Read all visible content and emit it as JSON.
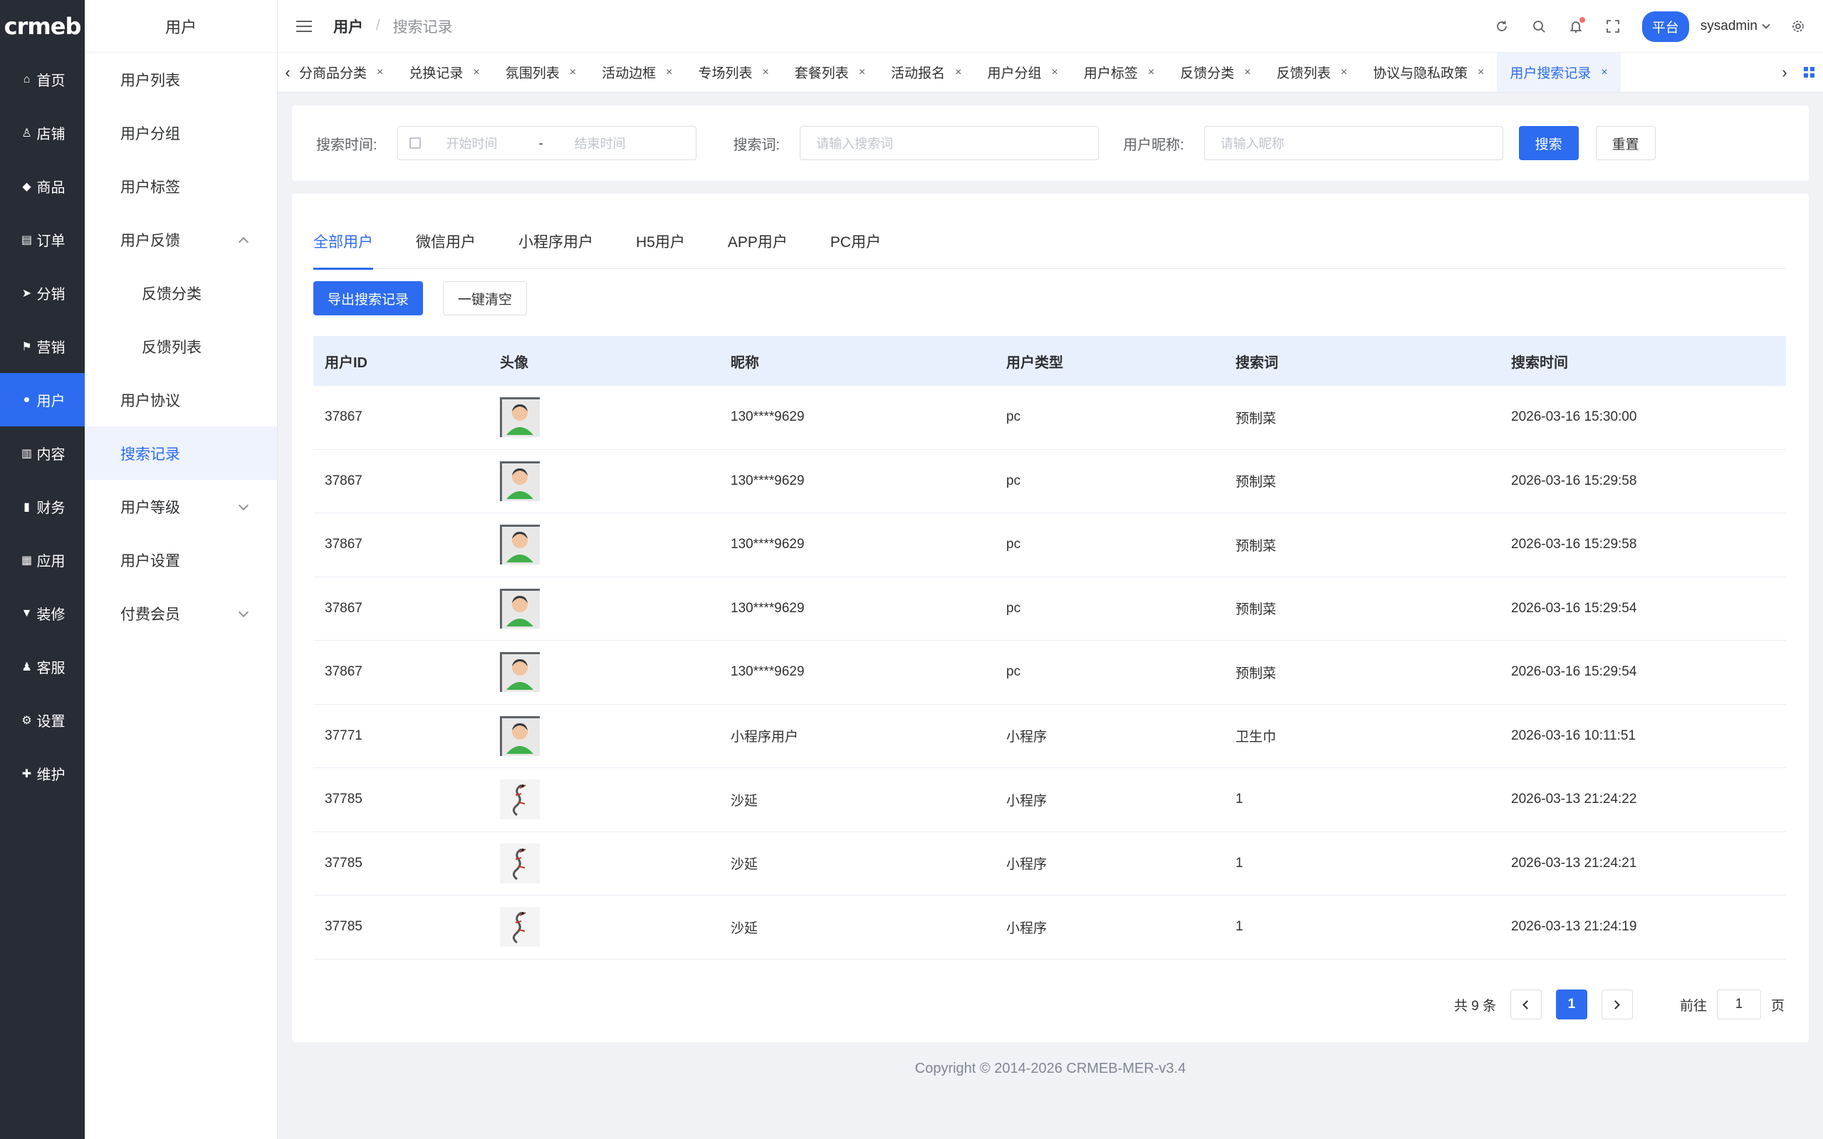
{
  "brand": {
    "logo": "crmeb",
    "accent": "#2d6cf0",
    "sidebar_bg": "#282c34"
  },
  "rail": [
    {
      "label": "首页",
      "icon": "home-icon",
      "glyph": "⌂"
    },
    {
      "label": "店铺",
      "icon": "store-icon",
      "glyph": "♙"
    },
    {
      "label": "商品",
      "icon": "goods-icon",
      "glyph": "◆"
    },
    {
      "label": "订单",
      "icon": "order-icon",
      "glyph": "▤"
    },
    {
      "label": "分销",
      "icon": "send-icon",
      "glyph": "➤"
    },
    {
      "label": "营销",
      "icon": "flag-icon",
      "glyph": "⚑"
    },
    {
      "label": "用户",
      "icon": "user-icon",
      "glyph": "●",
      "active": true
    },
    {
      "label": "内容",
      "icon": "content-icon",
      "glyph": "▥"
    },
    {
      "label": "财务",
      "icon": "finance-icon",
      "glyph": "▮"
    },
    {
      "label": "应用",
      "icon": "apps-icon",
      "glyph": "▦"
    },
    {
      "label": "装修",
      "icon": "decor-icon",
      "glyph": "▼"
    },
    {
      "label": "客服",
      "icon": "service-icon",
      "glyph": "♟"
    },
    {
      "label": "设置",
      "icon": "gear-icon",
      "glyph": "⚙"
    },
    {
      "label": "维护",
      "icon": "maintain-icon",
      "glyph": "✚"
    }
  ],
  "submenu": {
    "title": "用户",
    "items": [
      {
        "label": "用户列表"
      },
      {
        "label": "用户分组"
      },
      {
        "label": "用户标签"
      },
      {
        "label": "用户反馈",
        "expand": "up"
      },
      {
        "label": "反馈分类",
        "child": true
      },
      {
        "label": "反馈列表",
        "child": true
      },
      {
        "label": "用户协议"
      },
      {
        "label": "搜索记录",
        "active": true
      },
      {
        "label": "用户等级",
        "expand": "down"
      },
      {
        "label": "用户设置"
      },
      {
        "label": "付费会员",
        "expand": "down"
      }
    ]
  },
  "header": {
    "breadcrumb_parent": "用户",
    "breadcrumb_sep": "/",
    "breadcrumb_current": "搜索记录",
    "platform": "平台",
    "username": "sysadmin"
  },
  "tabs": [
    {
      "label": "分商品分类"
    },
    {
      "label": "兑换记录"
    },
    {
      "label": "氛围列表"
    },
    {
      "label": "活动边框"
    },
    {
      "label": "专场列表"
    },
    {
      "label": "套餐列表"
    },
    {
      "label": "活动报名"
    },
    {
      "label": "用户分组"
    },
    {
      "label": "用户标签"
    },
    {
      "label": "反馈分类"
    },
    {
      "label": "反馈列表"
    },
    {
      "label": "协议与隐私政策"
    },
    {
      "label": "用户搜索记录",
      "active": true
    }
  ],
  "search": {
    "time_label": "搜索时间:",
    "start_placeholder": "开始时间",
    "range_sep": "-",
    "end_placeholder": "结束时间",
    "keyword_label": "搜索词:",
    "keyword_placeholder": "请输入搜索词",
    "nickname_label": "用户昵称:",
    "nickname_placeholder": "请输入昵称",
    "search_btn": "搜索",
    "reset_btn": "重置"
  },
  "type_tabs": [
    {
      "label": "全部用户",
      "active": true
    },
    {
      "label": "微信用户"
    },
    {
      "label": "小程序用户"
    },
    {
      "label": "H5用户"
    },
    {
      "label": "APP用户"
    },
    {
      "label": "PC用户"
    }
  ],
  "actions": {
    "export": "导出搜索记录",
    "clear": "一键清空"
  },
  "table": {
    "columns": [
      "用户ID",
      "头像",
      "昵称",
      "用户类型",
      "搜索词",
      "搜索时间"
    ],
    "rows": [
      {
        "id": "37867",
        "avatar": "default-avatar",
        "nickname": "130****9629",
        "type": "pc",
        "keyword": "预制菜",
        "time": "2026-03-16 15:30:00"
      },
      {
        "id": "37867",
        "avatar": "default-avatar",
        "nickname": "130****9629",
        "type": "pc",
        "keyword": "预制菜",
        "time": "2026-03-16 15:29:58"
      },
      {
        "id": "37867",
        "avatar": "default-avatar",
        "nickname": "130****9629",
        "type": "pc",
        "keyword": "预制菜",
        "time": "2026-03-16 15:29:58"
      },
      {
        "id": "37867",
        "avatar": "default-avatar",
        "nickname": "130****9629",
        "type": "pc",
        "keyword": "预制菜",
        "time": "2026-03-16 15:29:54"
      },
      {
        "id": "37867",
        "avatar": "default-avatar",
        "nickname": "130****9629",
        "type": "pc",
        "keyword": "预制菜",
        "time": "2026-03-16 15:29:54"
      },
      {
        "id": "37771",
        "avatar": "default-avatar",
        "nickname": "小程序用户",
        "type": "小程序",
        "keyword": "卫生巾",
        "time": "2026-03-16 10:11:51"
      },
      {
        "id": "37785",
        "avatar": "dragon-avatar",
        "nickname": "沙延",
        "type": "小程序",
        "keyword": "1",
        "time": "2026-03-13 21:24:22"
      },
      {
        "id": "37785",
        "avatar": "dragon-avatar",
        "nickname": "沙延",
        "type": "小程序",
        "keyword": "1",
        "time": "2026-03-13 21:24:21"
      },
      {
        "id": "37785",
        "avatar": "dragon-avatar",
        "nickname": "沙延",
        "type": "小程序",
        "keyword": "1",
        "time": "2026-03-13 21:24:19"
      }
    ]
  },
  "pagination": {
    "total": "共 9 条",
    "current": "1",
    "goto_prefix": "前往",
    "goto_value": "1",
    "goto_suffix": "页"
  },
  "footer": "Copyright © 2014-2026 CRMEB-MER-v3.4"
}
